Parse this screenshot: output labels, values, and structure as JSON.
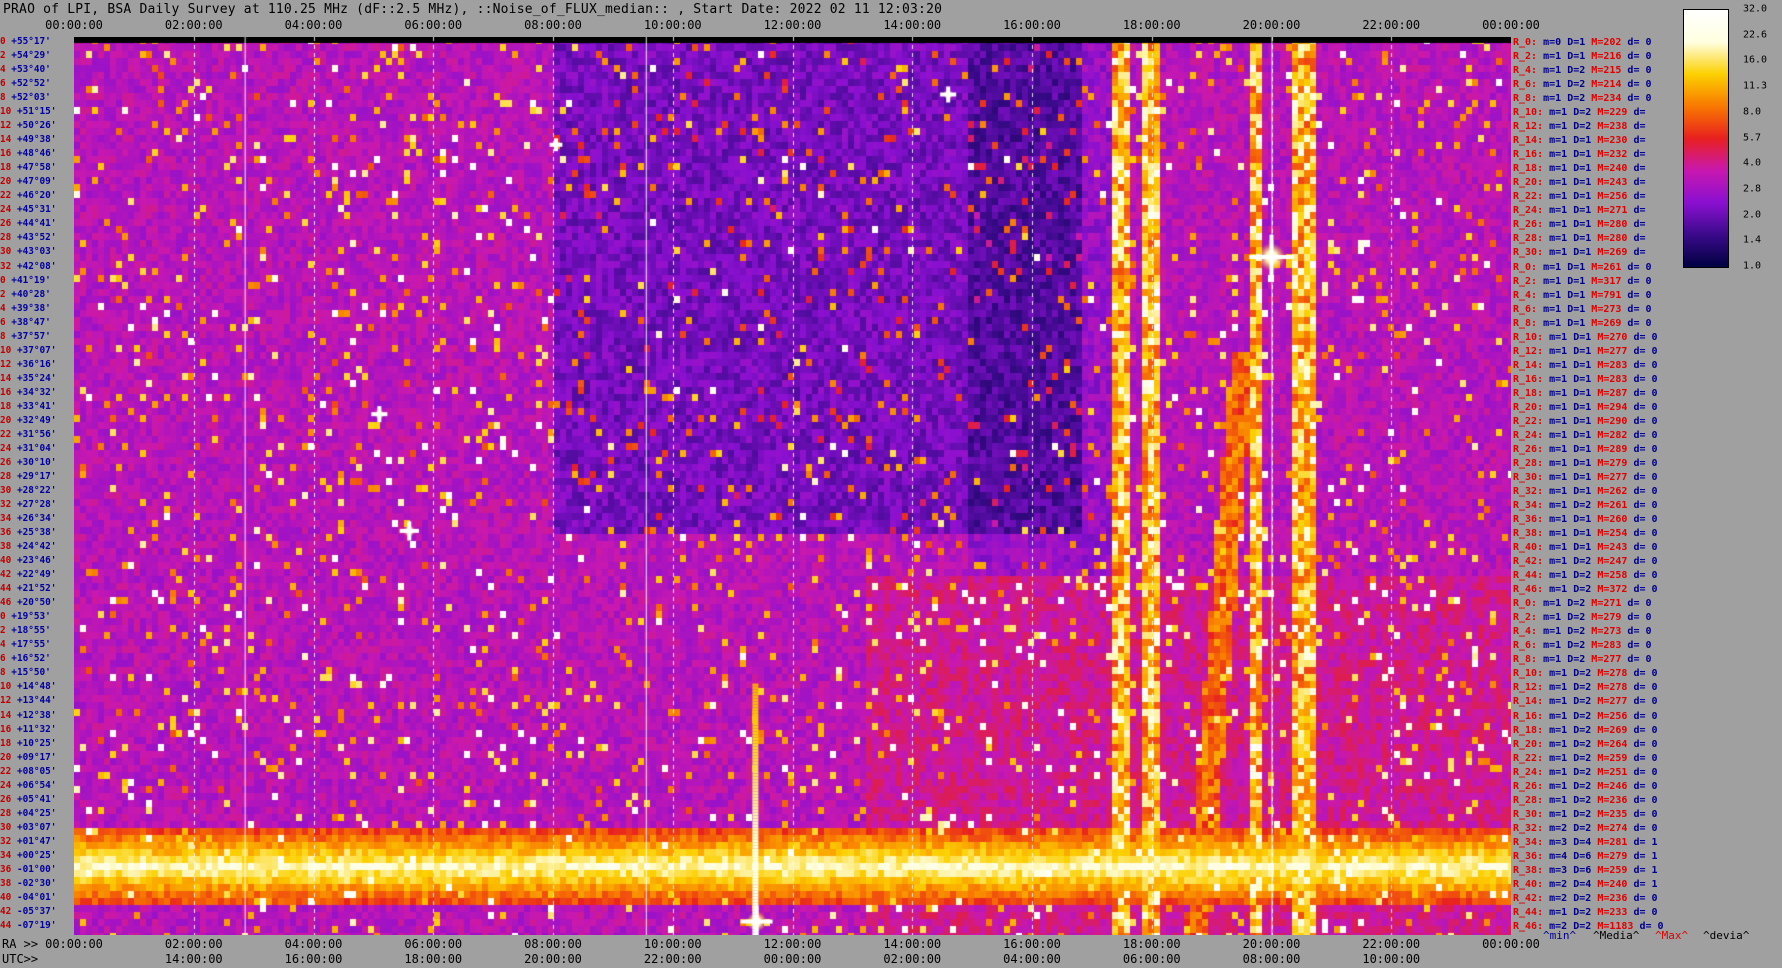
{
  "title": "PRAO of LPI, BSA Daily Survey at 110.25 MHz (dF::2.5 MHz), ::Noise_of_FLUX_median:: , Start Date: 2022 02 11 12:03:20",
  "axis": {
    "ra_label": "RA >>",
    "utc_label": "UTC>>",
    "top_ticks": [
      "00:00:00",
      "02:00:00",
      "04:00:00",
      "06:00:00",
      "08:00:00",
      "10:00:00",
      "12:00:00",
      "14:00:00",
      "16:00:00",
      "18:00:00",
      "20:00:00",
      "22:00:00",
      "00:00:00"
    ],
    "bottom_ticks": [
      "00:00:00",
      "02:00:00",
      "04:00:00",
      "06:00:00",
      "08:00:00",
      "10:00:00",
      "12:00:00",
      "14:00:00",
      "16:00:00",
      "18:00:00",
      "20:00:00",
      "22:00:00",
      "00:00:00"
    ],
    "utc_ticks": [
      "14:00:00",
      "16:00:00",
      "18:00:00",
      "20:00:00",
      "22:00:00",
      "00:00:00",
      "02:00:00",
      "04:00:00",
      "06:00:00",
      "08:00:00",
      "10:00:00"
    ]
  },
  "declinations": [
    "+55°17'",
    "+54°29'",
    "+53°40'",
    "+52°52'",
    "+52°03'",
    "+51°15'",
    "+50°26'",
    "+49°38'",
    "+48°46'",
    "+47°58'",
    "+47°09'",
    "+46°20'",
    "+45°31'",
    "+44°41'",
    "+43°52'",
    "+43°03'",
    "+42°08'",
    "+41°19'",
    "+40°28'",
    "+39°38'",
    "+38°47'",
    "+37°57'",
    "+37°07'",
    "+36°16'",
    "+35°24'",
    "+34°32'",
    "+33°41'",
    "+32°49'",
    "+31°56'",
    "+31°04'",
    "+30°10'",
    "+29°17'",
    "+28°22'",
    "+27°28'",
    "+26°34'",
    "+25°38'",
    "+24°42'",
    "+23°46'",
    "+22°49'",
    "+21°52'",
    "+20°50'",
    "+19°53'",
    "+18°55'",
    "+17°55'",
    "+16°52'",
    "+15°50'",
    "+14°48'",
    "+13°44'",
    "+12°38'",
    "+11°32'",
    "+10°25'",
    "+09°17'",
    "+08°05'",
    "+06°54'",
    "+05°41'",
    "+04°25'",
    "+03°07'",
    "+01°47'",
    "+00°25'",
    "-01°00'",
    "-02°30'",
    "-04°01'",
    "-05°37'",
    "-07°19'"
  ],
  "row_index": [
    "0",
    "2",
    "4",
    "6",
    "8",
    "10",
    "12",
    "14",
    "16",
    "18",
    "20",
    "22",
    "24",
    "26",
    "28",
    "30",
    "32",
    "0",
    "2",
    "4",
    "6",
    "8",
    "10",
    "12",
    "14",
    "16",
    "18",
    "20",
    "22",
    "24",
    "26",
    "28",
    "30",
    "32",
    "34",
    "36",
    "38",
    "40",
    "42",
    "44",
    "46",
    "0",
    "2",
    "4",
    "6",
    "8",
    "10",
    "12",
    "14",
    "16",
    "18",
    "20",
    "22",
    "24",
    "26",
    "28",
    "30",
    "32",
    "34",
    "36",
    "38",
    "40",
    "42",
    "44"
  ],
  "right_stats": [
    {
      "r": "R_0:",
      "m": "m=0",
      "d": "D=1",
      "max": "M=202",
      "dev": "d= 0"
    },
    {
      "r": "R_2:",
      "m": "m=1",
      "d": "D=1",
      "max": "M=216",
      "dev": "d= 0"
    },
    {
      "r": "R_4:",
      "m": "m=1",
      "d": "D=2",
      "max": "M=215",
      "dev": "d= 0"
    },
    {
      "r": "R_6:",
      "m": "m=1",
      "d": "D=2",
      "max": "M=214",
      "dev": "d= 0"
    },
    {
      "r": "R_8:",
      "m": "m=1",
      "d": "D=2",
      "max": "M=234",
      "dev": "d= 0"
    },
    {
      "r": "R_10:",
      "m": "m=1",
      "d": "D=2",
      "max": "M=229",
      "dev": "d="
    },
    {
      "r": "R_12:",
      "m": "m=1",
      "d": "D=2",
      "max": "M=238",
      "dev": "d="
    },
    {
      "r": "R_14:",
      "m": "m=1",
      "d": "D=1",
      "max": "M=230",
      "dev": "d="
    },
    {
      "r": "R_16:",
      "m": "m=1",
      "d": "D=1",
      "max": "M=232",
      "dev": "d="
    },
    {
      "r": "R_18:",
      "m": "m=1",
      "d": "D=1",
      "max": "M=240",
      "dev": "d="
    },
    {
      "r": "R_20:",
      "m": "m=1",
      "d": "D=1",
      "max": "M=243",
      "dev": "d="
    },
    {
      "r": "R_22:",
      "m": "m=1",
      "d": "D=1",
      "max": "M=256",
      "dev": "d="
    },
    {
      "r": "R_24:",
      "m": "m=1",
      "d": "D=1",
      "max": "M=271",
      "dev": "d="
    },
    {
      "r": "R_26:",
      "m": "m=1",
      "d": "D=1",
      "max": "M=280",
      "dev": "d="
    },
    {
      "r": "R_28:",
      "m": "m=1",
      "d": "D=1",
      "max": "M=280",
      "dev": "d="
    },
    {
      "r": "R_30:",
      "m": "m=1",
      "d": "D=1",
      "max": "M=269",
      "dev": "d="
    },
    {
      "r": "R_0:",
      "m": "m=1",
      "d": "D=1",
      "max": "M=261",
      "dev": "d= 0"
    },
    {
      "r": "R_2:",
      "m": "m=1",
      "d": "D=1",
      "max": "M=317",
      "dev": "d= 0"
    },
    {
      "r": "R_4:",
      "m": "m=1",
      "d": "D=1",
      "max": "M=791",
      "dev": "d= 0"
    },
    {
      "r": "R_6:",
      "m": "m=1",
      "d": "D=1",
      "max": "M=273",
      "dev": "d= 0"
    },
    {
      "r": "R_8:",
      "m": "m=1",
      "d": "D=1",
      "max": "M=269",
      "dev": "d= 0"
    },
    {
      "r": "R_10:",
      "m": "m=1",
      "d": "D=1",
      "max": "M=270",
      "dev": "d= 0"
    },
    {
      "r": "R_12:",
      "m": "m=1",
      "d": "D=1",
      "max": "M=277",
      "dev": "d= 0"
    },
    {
      "r": "R_14:",
      "m": "m=1",
      "d": "D=1",
      "max": "M=283",
      "dev": "d= 0"
    },
    {
      "r": "R_16:",
      "m": "m=1",
      "d": "D=1",
      "max": "M=283",
      "dev": "d= 0"
    },
    {
      "r": "R_18:",
      "m": "m=1",
      "d": "D=1",
      "max": "M=287",
      "dev": "d= 0"
    },
    {
      "r": "R_20:",
      "m": "m=1",
      "d": "D=1",
      "max": "M=294",
      "dev": "d= 0"
    },
    {
      "r": "R_22:",
      "m": "m=1",
      "d": "D=1",
      "max": "M=290",
      "dev": "d= 0"
    },
    {
      "r": "R_24:",
      "m": "m=1",
      "d": "D=1",
      "max": "M=282",
      "dev": "d= 0"
    },
    {
      "r": "R_26:",
      "m": "m=1",
      "d": "D=1",
      "max": "M=289",
      "dev": "d= 0"
    },
    {
      "r": "R_28:",
      "m": "m=1",
      "d": "D=1",
      "max": "M=279",
      "dev": "d= 0"
    },
    {
      "r": "R_30:",
      "m": "m=1",
      "d": "D=1",
      "max": "M=277",
      "dev": "d= 0"
    },
    {
      "r": "R_32:",
      "m": "m=1",
      "d": "D=1",
      "max": "M=262",
      "dev": "d= 0"
    },
    {
      "r": "R_34:",
      "m": "m=1",
      "d": "D=2",
      "max": "M=261",
      "dev": "d= 0"
    },
    {
      "r": "R_36:",
      "m": "m=1",
      "d": "D=1",
      "max": "M=260",
      "dev": "d= 0"
    },
    {
      "r": "R_38:",
      "m": "m=1",
      "d": "D=1",
      "max": "M=254",
      "dev": "d= 0"
    },
    {
      "r": "R_40:",
      "m": "m=1",
      "d": "D=1",
      "max": "M=243",
      "dev": "d= 0"
    },
    {
      "r": "R_42:",
      "m": "m=1",
      "d": "D=2",
      "max": "M=247",
      "dev": "d= 0"
    },
    {
      "r": "R_44:",
      "m": "m=1",
      "d": "D=2",
      "max": "M=258",
      "dev": "d= 0"
    },
    {
      "r": "R_46:",
      "m": "m=1",
      "d": "D=2",
      "max": "M=372",
      "dev": "d= 0"
    },
    {
      "r": "R_0:",
      "m": "m=1",
      "d": "D=2",
      "max": "M=271",
      "dev": "d= 0"
    },
    {
      "r": "R_2:",
      "m": "m=1",
      "d": "D=2",
      "max": "M=279",
      "dev": "d= 0"
    },
    {
      "r": "R_4:",
      "m": "m=1",
      "d": "D=2",
      "max": "M=273",
      "dev": "d= 0"
    },
    {
      "r": "R_6:",
      "m": "m=1",
      "d": "D=2",
      "max": "M=283",
      "dev": "d= 0"
    },
    {
      "r": "R_8:",
      "m": "m=1",
      "d": "D=2",
      "max": "M=277",
      "dev": "d= 0"
    },
    {
      "r": "R_10:",
      "m": "m=1",
      "d": "D=2",
      "max": "M=278",
      "dev": "d= 0"
    },
    {
      "r": "R_12:",
      "m": "m=1",
      "d": "D=2",
      "max": "M=278",
      "dev": "d= 0"
    },
    {
      "r": "R_14:",
      "m": "m=1",
      "d": "D=2",
      "max": "M=277",
      "dev": "d= 0"
    },
    {
      "r": "R_16:",
      "m": "m=1",
      "d": "D=2",
      "max": "M=256",
      "dev": "d= 0"
    },
    {
      "r": "R_18:",
      "m": "m=1",
      "d": "D=2",
      "max": "M=269",
      "dev": "d= 0"
    },
    {
      "r": "R_20:",
      "m": "m=1",
      "d": "D=2",
      "max": "M=264",
      "dev": "d= 0"
    },
    {
      "r": "R_22:",
      "m": "m=1",
      "d": "D=2",
      "max": "M=259",
      "dev": "d= 0"
    },
    {
      "r": "R_24:",
      "m": "m=1",
      "d": "D=2",
      "max": "M=251",
      "dev": "d= 0"
    },
    {
      "r": "R_26:",
      "m": "m=1",
      "d": "D=2",
      "max": "M=246",
      "dev": "d= 0"
    },
    {
      "r": "R_28:",
      "m": "m=1",
      "d": "D=2",
      "max": "M=236",
      "dev": "d= 0"
    },
    {
      "r": "R_30:",
      "m": "m=1",
      "d": "D=2",
      "max": "M=235",
      "dev": "d= 0"
    },
    {
      "r": "R_32:",
      "m": "m=2",
      "d": "D=2",
      "max": "M=274",
      "dev": "d= 0"
    },
    {
      "r": "R_34:",
      "m": "m=3",
      "d": "D=4",
      "max": "M=281",
      "dev": "d= 1"
    },
    {
      "r": "R_36:",
      "m": "m=4",
      "d": "D=6",
      "max": "M=279",
      "dev": "d= 1"
    },
    {
      "r": "R_38:",
      "m": "m=3",
      "d": "D=6",
      "max": "M=259",
      "dev": "d= 1"
    },
    {
      "r": "R_40:",
      "m": "m=2",
      "d": "D=4",
      "max": "M=240",
      "dev": "d= 1"
    },
    {
      "r": "R_42:",
      "m": "m=2",
      "d": "D=2",
      "max": "M=236",
      "dev": "d= 0"
    },
    {
      "r": "R_44:",
      "m": "m=1",
      "d": "D=2",
      "max": "M=233",
      "dev": "d= 0"
    },
    {
      "r": "R_46:",
      "m": "m=2",
      "d": "D=2",
      "max": "M=1183",
      "dev": "d= 0"
    }
  ],
  "legend_bottom": {
    "min": "^min^",
    "median": "^Media^",
    "max": "^Max^",
    "dev": "^devia^"
  },
  "colorbar": {
    "labels": [
      "32.0",
      "22.6",
      "16.0",
      "11.3",
      "8.0",
      "5.7",
      "4.0",
      "2.8",
      "2.0",
      "1.4",
      "1.0"
    ],
    "stops": [
      "#000040",
      "#3a0a8a",
      "#8a10d0",
      "#c818b0",
      "#e82020",
      "#f87800",
      "#fcd000",
      "#ffffe0",
      "#ffffff"
    ]
  },
  "chart_data": {
    "type": "heatmap",
    "title": "PRAO of LPI, BSA Daily Survey at 110.25 MHz (dF::2.5 MHz), ::Noise_of_FLUX_median:: , Start Date: 2022 02 11 12:03:20",
    "x_range": [
      "00:00:00",
      "00:00:00"
    ],
    "y_range": [
      "+55°17'",
      "-07°19'"
    ],
    "color_scale": [
      1.0,
      32.0
    ],
    "bright_bands_dec": [
      "+03°07'",
      "+01°47'",
      "+00°25'",
      "-01°00'",
      "-02°30'"
    ],
    "bright_columns_ra": [
      "17:30:00",
      "17:45:00",
      "18:10:00",
      "19:40:00",
      "20:15:00",
      "20:30:00"
    ],
    "strong_sources": [
      {
        "ra": "20:00:00",
        "dec": "+41°19'"
      },
      {
        "ra": "11:45:00",
        "dec": "-07°19'"
      },
      {
        "ra": "05:40:00",
        "dec": "+22°49'"
      }
    ]
  }
}
